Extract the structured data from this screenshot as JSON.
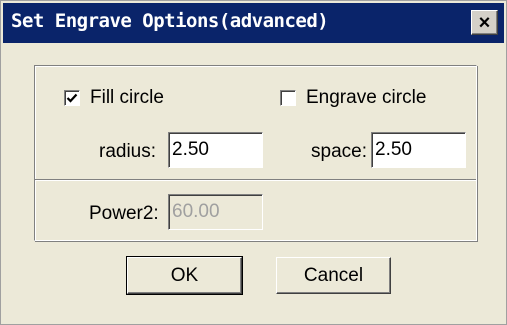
{
  "window": {
    "title": "Set Engrave Options(advanced)",
    "close_label": "×"
  },
  "options": {
    "fill_circle": {
      "label": "Fill circle",
      "checked": true
    },
    "engrave_circle": {
      "label": "Engrave circle",
      "checked": false
    },
    "radius": {
      "label": "radius:",
      "value": "2.50"
    },
    "space": {
      "label": "space:",
      "value": "2.50"
    },
    "power2": {
      "label": "Power2:",
      "value": "60.00",
      "disabled": true
    }
  },
  "buttons": {
    "ok": "OK",
    "cancel": "Cancel"
  },
  "colors": {
    "titlebar": "#0a246a",
    "face": "#ece9d8"
  },
  "icons": {
    "close": "close-icon",
    "check": "checkmark-icon"
  }
}
